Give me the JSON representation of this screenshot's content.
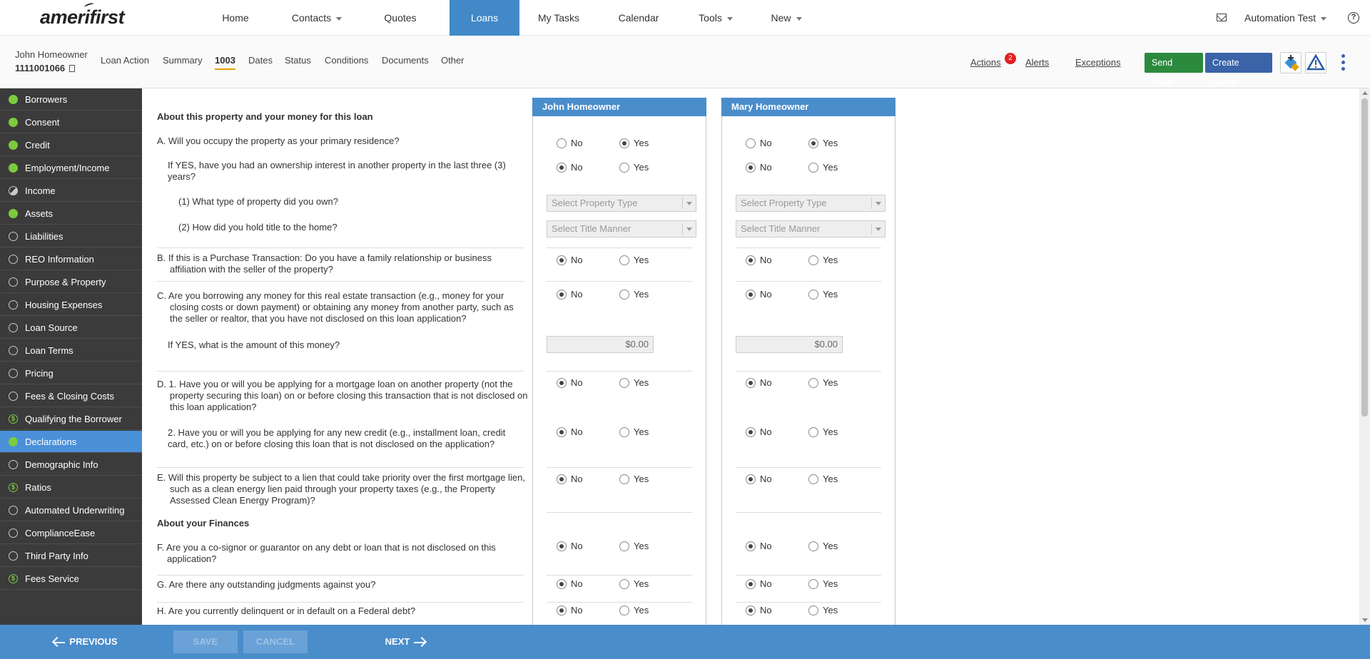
{
  "brand": {
    "logo_text": "amerifirst"
  },
  "nav": {
    "items": [
      "Home",
      "Contacts",
      "Quotes",
      "Loans",
      "My Tasks",
      "Calendar",
      "Tools",
      "New"
    ],
    "active": "Loans",
    "user": "Automation Test",
    "help": "?"
  },
  "loan": {
    "borrower": "John Homeowner",
    "number": "1111001066",
    "tabs": [
      "Loan Action",
      "Summary",
      "1003",
      "Dates",
      "Status",
      "Conditions",
      "Documents",
      "Other"
    ],
    "active_tab": "1003"
  },
  "header_actions": {
    "actions_label": "Actions",
    "actions_badge": "2",
    "alerts_label": "Alerts",
    "exceptions_label": "Exceptions",
    "send_invite": "Send Invite",
    "create_quote": "Create Quote"
  },
  "sidebar": {
    "items": [
      {
        "label": "Borrowers",
        "status": "done"
      },
      {
        "label": "Consent",
        "status": "done"
      },
      {
        "label": "Credit",
        "status": "done"
      },
      {
        "label": "Employment/Income",
        "status": "done"
      },
      {
        "label": "Income",
        "status": "half"
      },
      {
        "label": "Assets",
        "status": "done"
      },
      {
        "label": "Liabilities",
        "status": "empty"
      },
      {
        "label": "REO Information",
        "status": "empty"
      },
      {
        "label": "Purpose & Property",
        "status": "empty"
      },
      {
        "label": "Housing Expenses",
        "status": "empty"
      },
      {
        "label": "Loan Source",
        "status": "empty"
      },
      {
        "label": "Loan Terms",
        "status": "empty"
      },
      {
        "label": "Pricing",
        "status": "empty"
      },
      {
        "label": "Fees & Closing Costs",
        "status": "empty"
      },
      {
        "label": "Qualifying the Borrower",
        "status": "dollar"
      },
      {
        "label": "Declarations",
        "status": "done",
        "active": true
      },
      {
        "label": "Demographic Info",
        "status": "empty"
      },
      {
        "label": "Ratios",
        "status": "dollar"
      },
      {
        "label": "Automated Underwriting",
        "status": "empty"
      },
      {
        "label": "ComplianceEase",
        "status": "empty"
      },
      {
        "label": "Third Party Info",
        "status": "empty"
      },
      {
        "label": "Fees Service",
        "status": "dollar"
      }
    ]
  },
  "declarations": {
    "section1_title": "About this property and your money for this loan",
    "section2_title": "About your Finances",
    "questions": {
      "a": "A. Will you occupy the property as your primary residence?",
      "a_sub": "If YES, have you had an ownership interest in another property in the last three (3) years?",
      "a_sub1": "(1) What type of property did you own?",
      "a_sub2": "(2) How did you hold title to the home?",
      "b": "B. If this is a Purchase Transaction: Do you have a family relationship or business affiliation with the seller of the property?",
      "c": "C. Are you borrowing any money for this real estate transaction (e.g., money for your closing costs or down payment) or obtaining any money from another party, such as the seller or realtor, that you have not disclosed on this loan application?",
      "c_sub": "If YES, what is the amount of this money?",
      "d1": "D. 1. Have you or will you be applying for a mortgage loan on another property (not the property securing this loan) on or before closing this transaction that is not disclosed on this loan application?",
      "d2": "2. Have you or will you be applying for any new credit (e.g., installment loan, credit card, etc.) on or before closing this loan that is not disclosed on the application?",
      "e": "E. Will this property be subject to a lien that could take priority over the first mortgage lien, such as a clean energy lien paid through your property taxes (e.g., the Property Assessed Clean Energy Program)?",
      "f": "F. Are you a co-signor or guarantor on any debt or loan that is not disclosed on this application?",
      "g": "G. Are there any outstanding judgments against you?",
      "h": "H. Are you currently delinquent or in default on a Federal debt?"
    },
    "labels": {
      "no": "No",
      "yes": "Yes"
    },
    "property_type_placeholder": "Select Property Type",
    "title_manner_placeholder": "Select Title Manner",
    "borrowers": [
      {
        "name": "John Homeowner",
        "amount": "$0.00"
      },
      {
        "name": "Mary Homeowner",
        "amount": "$0.00"
      }
    ]
  },
  "footer": {
    "previous": "PREVIOUS",
    "save": "SAVE",
    "cancel": "CANCEL",
    "next": "NEXT"
  }
}
